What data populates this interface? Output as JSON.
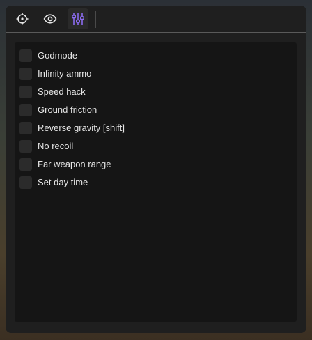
{
  "toolbar": {
    "tabs": [
      {
        "icon": "crosshair-icon",
        "active": false
      },
      {
        "icon": "eye-icon",
        "active": false
      },
      {
        "icon": "sliders-icon",
        "active": true
      }
    ]
  },
  "colors": {
    "accent": "#8b6cf0",
    "icon": "#e8e8e8",
    "panel": "#1f1f1f",
    "content": "#151515",
    "checkbox": "#2b2b2b"
  },
  "options": [
    {
      "label": "Godmode",
      "checked": false
    },
    {
      "label": "Infinity ammo",
      "checked": false
    },
    {
      "label": "Speed hack",
      "checked": false
    },
    {
      "label": "Ground friction",
      "checked": false
    },
    {
      "label": "Reverse gravity [shift]",
      "checked": false
    },
    {
      "label": "No recoil",
      "checked": false
    },
    {
      "label": "Far weapon range",
      "checked": false
    },
    {
      "label": "Set day time",
      "checked": false
    }
  ]
}
